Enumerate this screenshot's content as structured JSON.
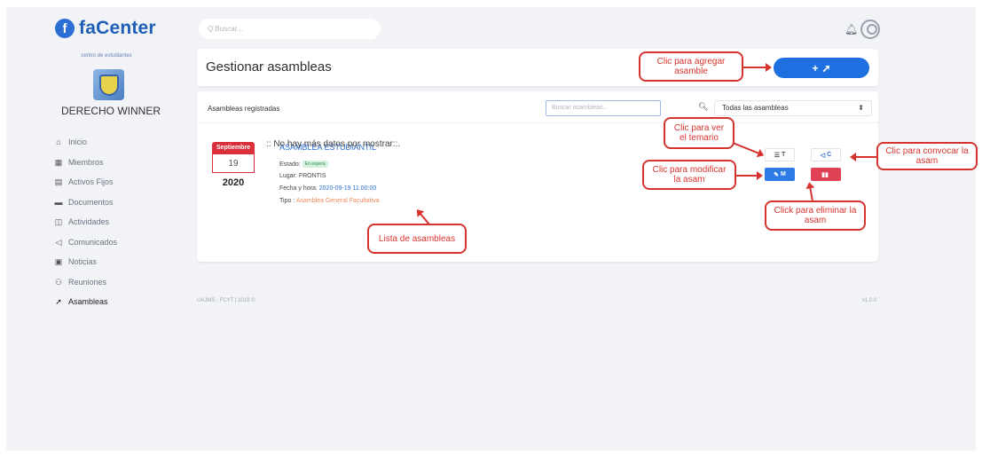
{
  "app": {
    "logo_mark": "f",
    "logo_text": "faCenter"
  },
  "sidebar": {
    "center_label": "centro de estudiantes",
    "org_name": "DERECHO WINNER",
    "items": [
      {
        "label": "Inicio",
        "icon": "home-icon",
        "glyph": "⌂"
      },
      {
        "label": "Miembros",
        "icon": "members-icon",
        "glyph": "▦"
      },
      {
        "label": "Activos Fijos",
        "icon": "assets-icon",
        "glyph": "▤"
      },
      {
        "label": "Documentos",
        "icon": "folder-icon",
        "glyph": "▬"
      },
      {
        "label": "Actividades",
        "icon": "activities-icon",
        "glyph": "◫"
      },
      {
        "label": "Comunicados",
        "icon": "megaphone-icon",
        "glyph": "◁"
      },
      {
        "label": "Noticias",
        "icon": "news-icon",
        "glyph": "▣"
      },
      {
        "label": "Reuniones",
        "icon": "meetings-icon",
        "glyph": "⚇"
      },
      {
        "label": "Asambleas",
        "icon": "gavel-icon",
        "glyph": "➚"
      }
    ]
  },
  "topbar": {
    "search_placeholder": "Q Buscar..."
  },
  "header": {
    "title": "Gestionar asambleas",
    "add_label": "+"
  },
  "list": {
    "title": "Asambleas registradas",
    "search_placeholder": "Buscar asambleas...",
    "filter_value": "Todas las asambleas",
    "items": [
      {
        "month": "Septiembre",
        "day": "19",
        "year": "2020",
        "title": "ASAMBLEA ESTUDIANTIL",
        "estado_label": "Estado:",
        "estado_badge": "En espera",
        "lugar_label": "Lugar:",
        "lugar": "FRONTIS",
        "fecha_label": "Fecha y hora:",
        "fecha": "2020-09-19 11:00:00",
        "tipo_label": "Tipo :",
        "tipo": "Asamblea General Facultativa",
        "btn_t": "T",
        "btn_c": "C",
        "btn_m": "M",
        "btn_e": ""
      }
    ],
    "no_data": ":: No hay más datos por mostrar::."
  },
  "footer": {
    "left": "UAJMS - FCYT | 2019 ©",
    "right": "v1.0.0"
  },
  "annotations": {
    "add": "Clic para agregar asamble",
    "temario": "Clic para ver el temario",
    "convocar": "Clic para convocar la asam",
    "modificar": "Clic para modificar la asam",
    "eliminar": "Click para eliminar la asam",
    "lista": "Lista de asambleas"
  },
  "colors": {
    "primary": "#1e6fe0",
    "danger": "#e04154",
    "annotation": "#d6332f"
  }
}
